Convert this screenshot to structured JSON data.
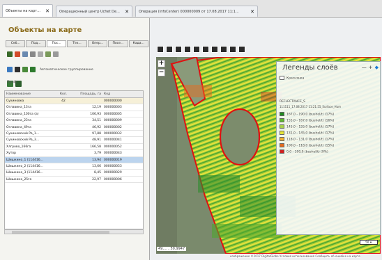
{
  "tabs": [
    {
      "label": "Объекты на карт...",
      "active": true
    },
    {
      "label": "Операционный центр Uchet De...",
      "active": false
    },
    {
      "label": "Операция (InfoCenter) 000000009 от 17.08.2017 11:1...",
      "active": false
    }
  ],
  "close_glyph": "✕",
  "left": {
    "title": "Объекты на карте",
    "subtabs": [
      "Себ...",
      "Под...",
      "Пос...",
      "Тех...",
      "Опер...",
      "Посе...",
      "Када..."
    ],
    "grouping_label": "Автоматическое группирование",
    "small_label": "Краф",
    "columns": [
      "Наименование",
      "Кол.",
      "Площадь, га",
      "Код"
    ],
    "rows": [
      {
        "name": "Сухиновка",
        "qty": "42",
        "area": "",
        "code": "000000000",
        "group": true
      },
      {
        "name": "Оглавина_13га",
        "qty": "",
        "area": "12,19",
        "code": "000000003"
      },
      {
        "name": "Оглавина_100га (a)",
        "qty": "",
        "area": "106,93",
        "code": "000000005"
      },
      {
        "name": "Оглавина_23га",
        "qty": "",
        "area": "34,51",
        "code": "000000009"
      },
      {
        "name": "Оглавина_49га",
        "qty": "",
        "area": "46,92",
        "code": "000000002"
      },
      {
        "name": "Сухиновский Ра_1...",
        "qty": "",
        "area": "97,88",
        "code": "000000032"
      },
      {
        "name": "Сухиновский Ра_3...",
        "qty": "",
        "area": "48,91",
        "code": "000000041"
      },
      {
        "name": "Хлгрово_166га",
        "qty": "",
        "area": "166,58",
        "code": "000000052"
      },
      {
        "name": "Хутор",
        "qty": "",
        "area": "3,79",
        "code": "000000043"
      },
      {
        "name": "Шишкино_1 (114416...",
        "qty": "",
        "area": "13,94",
        "code": "000000019",
        "selected": true
      },
      {
        "name": "Шишкино_2 (114416...",
        "qty": "",
        "area": "13,66",
        "code": "000000053"
      },
      {
        "name": "Шишкино_3 (114416...",
        "qty": "",
        "area": "8,45",
        "code": "000000029"
      },
      {
        "name": "Шишкино_25га",
        "qty": "",
        "area": "22,97",
        "code": "000000006"
      }
    ]
  },
  "map": {
    "legend_title": "Легенды слоёв",
    "legend_layer": "Краснянка",
    "legend_group": "REFLECTANCE_S",
    "legend_group_sub": "111111_17.08.2017 11:21:55_Surface_Hum",
    "legend_items": [
      {
        "label": "167,0 - 190,0 (bushel/t) (17%)",
        "color": "#1f8a1f"
      },
      {
        "label": "155,0 - 167,0 (bushel/t) (16%)",
        "color": "#5fb830"
      },
      {
        "label": "145,0 - 155,0 (bushel/t) (17%)",
        "color": "#a8d34a"
      },
      {
        "label": "131,0 - 145,0 (bushel/t) (17%)",
        "color": "#e5e535"
      },
      {
        "label": "118,0 - 131,0 (bushel/t) (17%)",
        "color": "#f0b030"
      },
      {
        "label": "100,0 - 118,0 (bushel/t) (15%)",
        "color": "#e36b1f"
      },
      {
        "label": "0,0 - 100,0 (bushel/t) (9%)",
        "color": "#d12020"
      }
    ],
    "coordinates": "49,... , 50,9947",
    "attribution": "изображение ©2017 DigitalGlobe   Условия использования   Сообщить об ошибке на карте",
    "scale": "50 м",
    "legend_button_collapse": "—",
    "legend_button_expand": "+",
    "zoom_in": "+",
    "zoom_out": "−"
  },
  "colors": {
    "title_gold": "#8a6a18",
    "selected_row": "#bcd4ee",
    "field_border": "#e01010"
  }
}
